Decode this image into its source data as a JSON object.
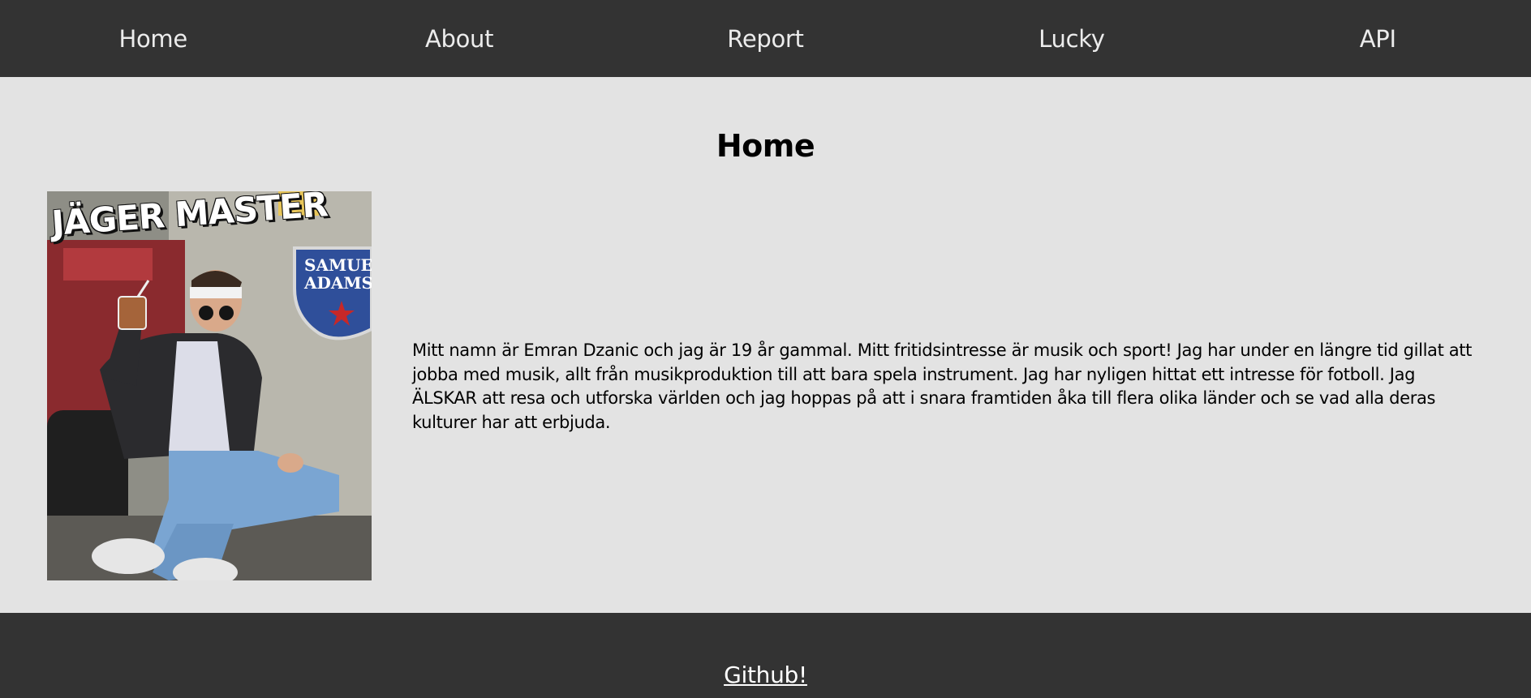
{
  "nav": {
    "items": [
      {
        "label": "Home"
      },
      {
        "label": "About"
      },
      {
        "label": "Report"
      },
      {
        "label": "Lucky"
      },
      {
        "label": "API"
      }
    ]
  },
  "main": {
    "title": "Home",
    "photo": {
      "caption": "JÄGER MASTER",
      "sign_line1": "SAMUE",
      "sign_line2": "ADAMS"
    },
    "bio": "Mitt namn är Emran Dzanic och jag är 19 år gammal. Mitt fritidsintresse är musik och sport! Jag har under en längre tid gillat att jobba med musik, allt från musikproduktion till att bara spela instrument. Jag har nyligen hittat ett intresse för fotboll. Jag ÄLSKAR att resa och utforska världen och jag hoppas på att i snara framtiden åka till flera olika länder och se vad alla deras kulturer har att erbjuda."
  },
  "footer": {
    "link_label": "Github!"
  },
  "colors": {
    "nav_bg": "#333333",
    "page_bg": "#e3e3e3",
    "nav_text": "#ececec"
  }
}
